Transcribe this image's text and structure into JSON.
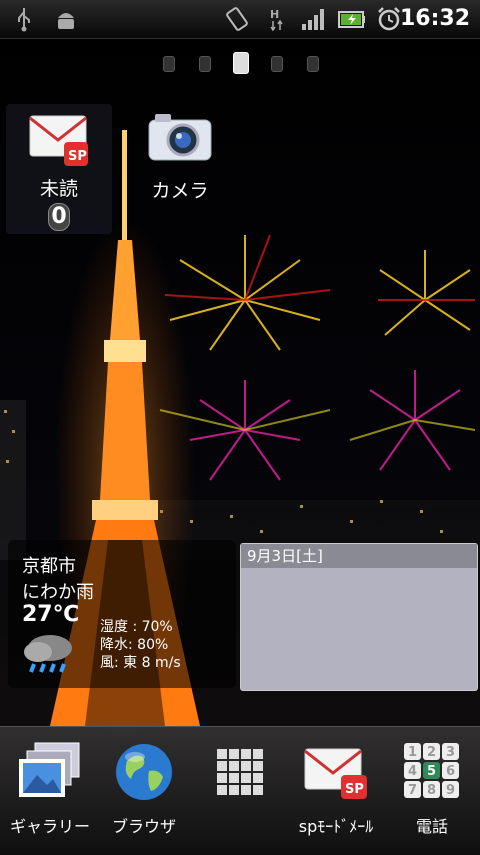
{
  "status_bar": {
    "icons": [
      "usb-icon",
      "android-debug-icon",
      "rotate-icon",
      "hsdpa-icon",
      "signal-icon",
      "battery-icon",
      "alarm-icon"
    ],
    "time": "16:32"
  },
  "pager": {
    "count": 5,
    "active": 2
  },
  "home": {
    "unread_app": {
      "label": "未読",
      "count": "0"
    },
    "camera_app": {
      "label": "カメラ"
    }
  },
  "weather": {
    "city": "京都市",
    "condition": "にわか雨",
    "temperature": "27℃",
    "humidity": "湿度 : 70%",
    "precipitation": "降水: 80%",
    "wind": "風: 東 8 m/s"
  },
  "calendar": {
    "date": "9月3日[土]"
  },
  "dock": {
    "gallery": "ギャラリー",
    "browser": "ブラウザ",
    "sp_mail": "spﾓｰﾄﾞﾒｰﾙ",
    "phone": "電話",
    "dialpad_digits": [
      "1",
      "2",
      "3",
      "4",
      "5",
      "6",
      "7",
      "8",
      "9"
    ]
  },
  "colors": {
    "mail_red": "#e03030",
    "phone_key_highlight": "#2e8b57"
  }
}
